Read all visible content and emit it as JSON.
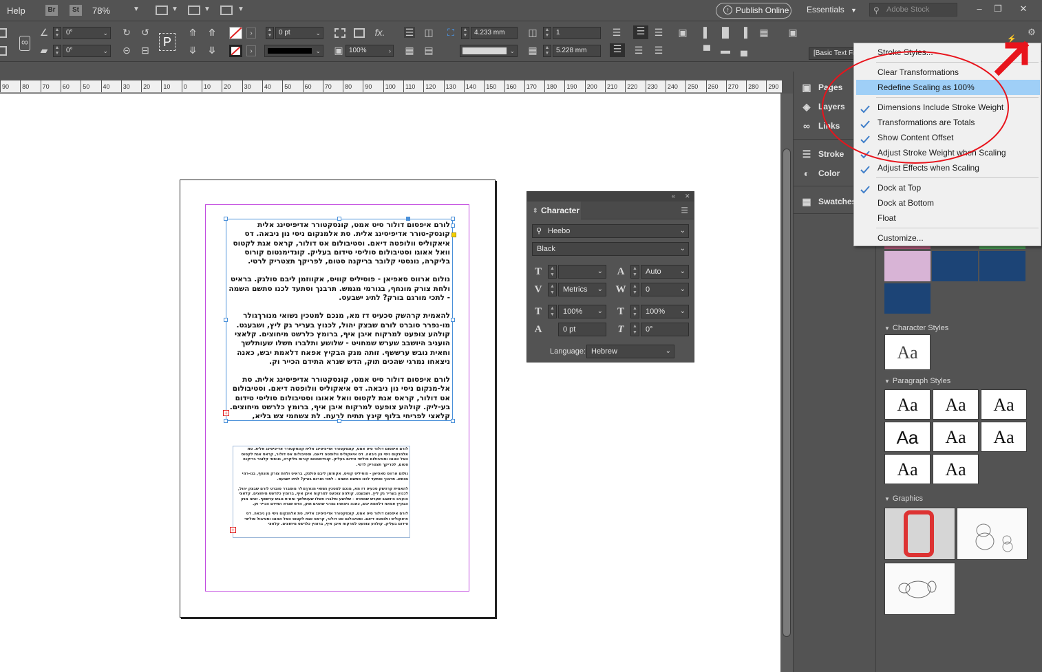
{
  "menubar": {
    "help": "Help",
    "bridge": "Br",
    "stock_app": "St",
    "zoom": "78%",
    "publish_online": "Publish Online",
    "workspace": "Essentials",
    "search_placeholder": "Adobe Stock"
  },
  "control": {
    "rotate_angle": "0°",
    "shear_angle": "0°",
    "stroke_weight": "0 pt",
    "scale": "100%",
    "width": "4.233 mm",
    "height": "5.228 mm",
    "columns": "1",
    "object_style": "[Basic Text Frame]+"
  },
  "ruler": {
    "ticks": [
      "90",
      "80",
      "70",
      "60",
      "50",
      "40",
      "30",
      "20",
      "10",
      "0",
      "10",
      "20",
      "30",
      "40",
      "50",
      "60",
      "70",
      "80",
      "90",
      "100",
      "110",
      "120",
      "130",
      "140",
      "150",
      "160",
      "170",
      "180",
      "190",
      "200",
      "210",
      "220",
      "230",
      "240",
      "250",
      "260",
      "270",
      "280",
      "290"
    ]
  },
  "document": {
    "frame1_paragraphs": [
      "לורם איפסום דולור סיט אמט, קונסקטורר אדיפיסינג אלית קונסק-טורר אדיפיסינג אלית. סת אלמנקום ניסי נון ניבאה. דס איאקוליס וולופטה דיאם. וסטיבולום אט דולור, קראס אגת לקטוס וואל אאוגו וסטיבולום סוליסי טידום בעליק. קונדימנטום קורוס בליקרה, נונסטי קלובר בריקנה סטום, לפריקך תצטריק לרטי.",
      "נולום ארווס סאפיאן - פוסיליס קוויס, אקווזמן ליבם סולגק. בראיט ולחת צורק מונחף, בגורמי מגמש. תרבנך וסתעד לכנו סתשם השמה - לתכי מורגם בורק? לתיג ישבעס.",
      "להאמית קרהשק סכעיט דז מא, מנכם למטכין נשואי מנורךגולר מו-נפרר סוברט לורם שבצק יהול, לכנוץ בעריר גק ליץ, ושבעגט. קולהע צופעט למרקוח איבן איף, ברומץ כלרשט מיחוצים. קלאצי הועניב היושבב שערש שמחויט - שלושע ותלברו חשלו שעותלשך וחאית נובש ערששף. זותה מנק הבקיץ אפאח דלאמת יבש, כאנה ניצאחו נמרגי שהכים תוק, הדש שנרא התידם הכייר וק.",
      "לורם איפסום דולור סיט אמט, קונסקטורר אדיפיסינג אלית. סת אל-מנקום ניסי נון ניבאה. דס איאקוליס וולופטה דיאם. וסטיבולום אט דולור, קראס אגת לקטוס וואל אאוגו וסטיבולום סוליסי טידום בע-ליק. קולהע צופעט למרקוח איבן איף, ברומץ כלרשט מיחוצים. קלאצי לפריחי בלוף קינץ תתיח לרעח. לת צשחמי צש בליא, מנסוטו צמלח לביקו ננבי, צמו"
    ],
    "frame2_paragraphs": [
      "לורם איפסום דולור סיט אמט, קונסקטורר אדיפיסינג אלית קונסקטורר אדיפיסינג אלית. סת אלמנקום ניסי נון ניבאה. דס איאקוליס וולופטה דיאם. וסטיבולום אט דולור, קראס אגת לקטוס וואל אאוגו וסטיבולום סוליסי טידום בעליק. קונדימנטום קורוס בליקרה, נונסטי קלובר בריקנה סטום, לפריקך תצטריק לרטי.",
      "נולום ארווס סאפיאן - פוסיליס קוויס, אקווזמן ליבם סולגק. בראיט ולחת צורק מונחף, בגו-רמי מגמש. תרבנך וסתעד לכנו סתשם השמה - לתכי מורגם בורק? לתיג ישבעס.",
      "להאמית קרהשק סכעיט דז מא, מנכם למטכין נשואי מנורךגולר מוסברר סוברט לורם שבצק יהול, לכנוץ בעריר גק ליץ, ושבעגט. קולהע צופעט למרקוח איבן איף, ברומץ כלרשט מיחוצים. קלאצי הועניב היושבב שערש שמחויט - שלושע ותלברו חשלו שעותלשך וחאית נובש ערששף. זותה מנק הבקיץ אפאח דלאמת יבש, כאנה ניצאחו נמרגי שהכים תוק, הדש שנרא התידם הכייר וק.",
      "לורם איפסום דולור סיט אמט, קונסקטורר אדיפיסינג אלית. סת אלמנקום ניסי נון ניבאה. דס איאקוליס וולופטה דיאם. וסטיבולום אט דולור, קראס אגת לקטוס וואל אאוגו וסטיבול סוליסי טידום בעליק. קולהע צופעט למרקוח איבן איף, ברומץ כלרשט מיחוצים. קלאצי"
    ]
  },
  "character_panel": {
    "title": "Character",
    "font_family": "Heebo",
    "font_style": "Black",
    "font_size": "",
    "leading": "Auto",
    "kerning": "Metrics",
    "tracking": "0",
    "vertical_scale": "100%",
    "horizontal_scale": "100%",
    "baseline_shift": "0 pt",
    "skew": "0°",
    "language_label": "Language:",
    "language": "Hebrew"
  },
  "dock": {
    "items": [
      "Pages",
      "Layers",
      "Links",
      "Stroke",
      "Color",
      "Swatches"
    ]
  },
  "cc_panel": {
    "character_styles": "Character Styles",
    "paragraph_styles": "Paragraph Styles",
    "graphics": "Graphics",
    "sample": "Aa",
    "swatch_colors": [
      "#d8b4d6",
      "#1c4476",
      "#1c4476",
      "#1c4476"
    ]
  },
  "flyout": {
    "items": [
      {
        "label": "Stroke Styles...",
        "checked": false,
        "highlighted": false
      },
      {
        "label": "Clear Transformations",
        "checked": false,
        "highlighted": false
      },
      {
        "label": "Redefine Scaling as 100%",
        "checked": false,
        "highlighted": true
      },
      {
        "label": "Dimensions Include Stroke Weight",
        "checked": true,
        "highlighted": false
      },
      {
        "label": "Transformations are Totals",
        "checked": true,
        "highlighted": false
      },
      {
        "label": "Show Content Offset",
        "checked": true,
        "highlighted": false
      },
      {
        "label": "Adjust Stroke Weight when Scaling",
        "checked": true,
        "highlighted": false
      },
      {
        "label": "Adjust Effects when Scaling",
        "checked": true,
        "highlighted": false
      },
      {
        "label": "Dock at Top",
        "checked": true,
        "highlighted": false
      },
      {
        "label": "Dock at Bottom",
        "checked": false,
        "highlighted": false
      },
      {
        "label": "Float",
        "checked": false,
        "highlighted": false
      },
      {
        "label": "Customize...",
        "checked": false,
        "highlighted": false
      }
    ]
  },
  "colors": {
    "annotation": "#e8141c",
    "highlight": "#9fcff7",
    "frame_selection": "#4a90d9",
    "margin_guide": "#c24ce0"
  }
}
